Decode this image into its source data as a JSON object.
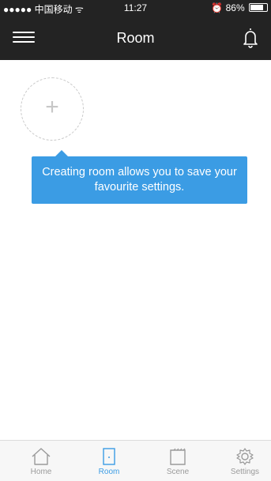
{
  "status_bar": {
    "carrier": "●●●●● 中国移动 ᯤ",
    "time": "11:27",
    "battery": "86%"
  },
  "header": {
    "title": "Room"
  },
  "empty_state": {
    "add_symbol": "+",
    "tooltip": "Creating room allows you to save your favourite settings."
  },
  "tabs": [
    {
      "label": "Home",
      "icon": "home-icon",
      "active": false
    },
    {
      "label": "Room",
      "icon": "door-icon",
      "active": true
    },
    {
      "label": "Scene",
      "icon": "scene-icon",
      "active": false
    },
    {
      "label": "Settings",
      "icon": "gear-icon",
      "active": false
    }
  ],
  "colors": {
    "accent": "#3b9ce4",
    "header_bg": "#232323",
    "tab_inactive": "#9a9a9a"
  }
}
